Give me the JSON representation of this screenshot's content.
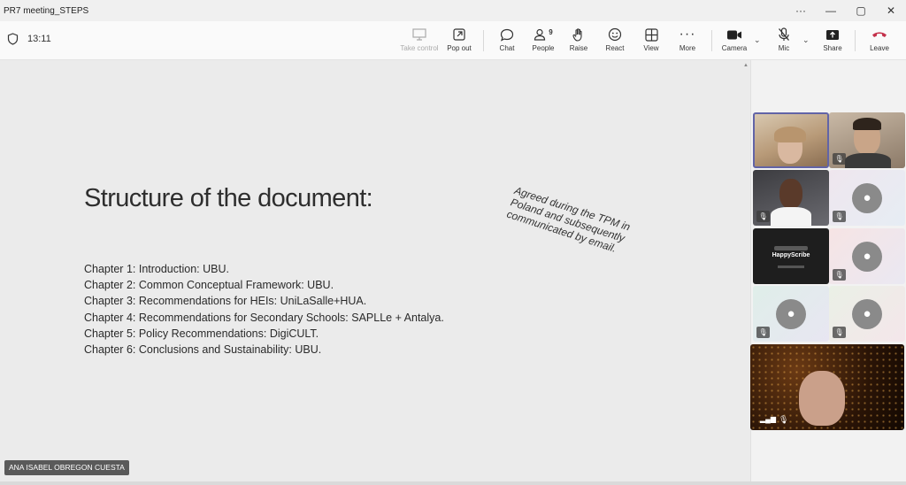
{
  "window": {
    "title": "PR7 meeting_STEPS",
    "controls": [
      "···",
      "—",
      "▢",
      "✕"
    ]
  },
  "toolbar": {
    "time": "13:11",
    "buttons": {
      "take_control": "Take control",
      "pop_out": "Pop out",
      "chat": "Chat",
      "people": "People",
      "people_count": "9",
      "raise": "Raise",
      "react": "React",
      "view": "View",
      "more": "More",
      "camera": "Camera",
      "mic": "Mic",
      "share": "Share",
      "leave": "Leave"
    },
    "leave_color": "#c4314b"
  },
  "slide": {
    "title": "Structure of the document:",
    "chapters": [
      "Chapter 1: Introduction: UBU.",
      "Chapter 2: Common Conceptual Framework: UBU.",
      "Chapter 3: Recommendations for HEIs: UniLaSalle+HUA.",
      "Chapter 4: Recommendations for Secondary Schools: SAPLLe + Antalya.",
      "Chapter 5: Policy Recommendations: DigiCULT.",
      "Chapter 6: Conclusions and Sustainability: UBU."
    ],
    "note": "Agreed during the TPM in Poland and subsequently communicated by email."
  },
  "presenter": {
    "name": "ANA ISABEL OBREGON CUESTA"
  },
  "gallery": {
    "app_tile_label": "HappyScribe"
  },
  "colors": {
    "active_border": "#6264a7"
  }
}
